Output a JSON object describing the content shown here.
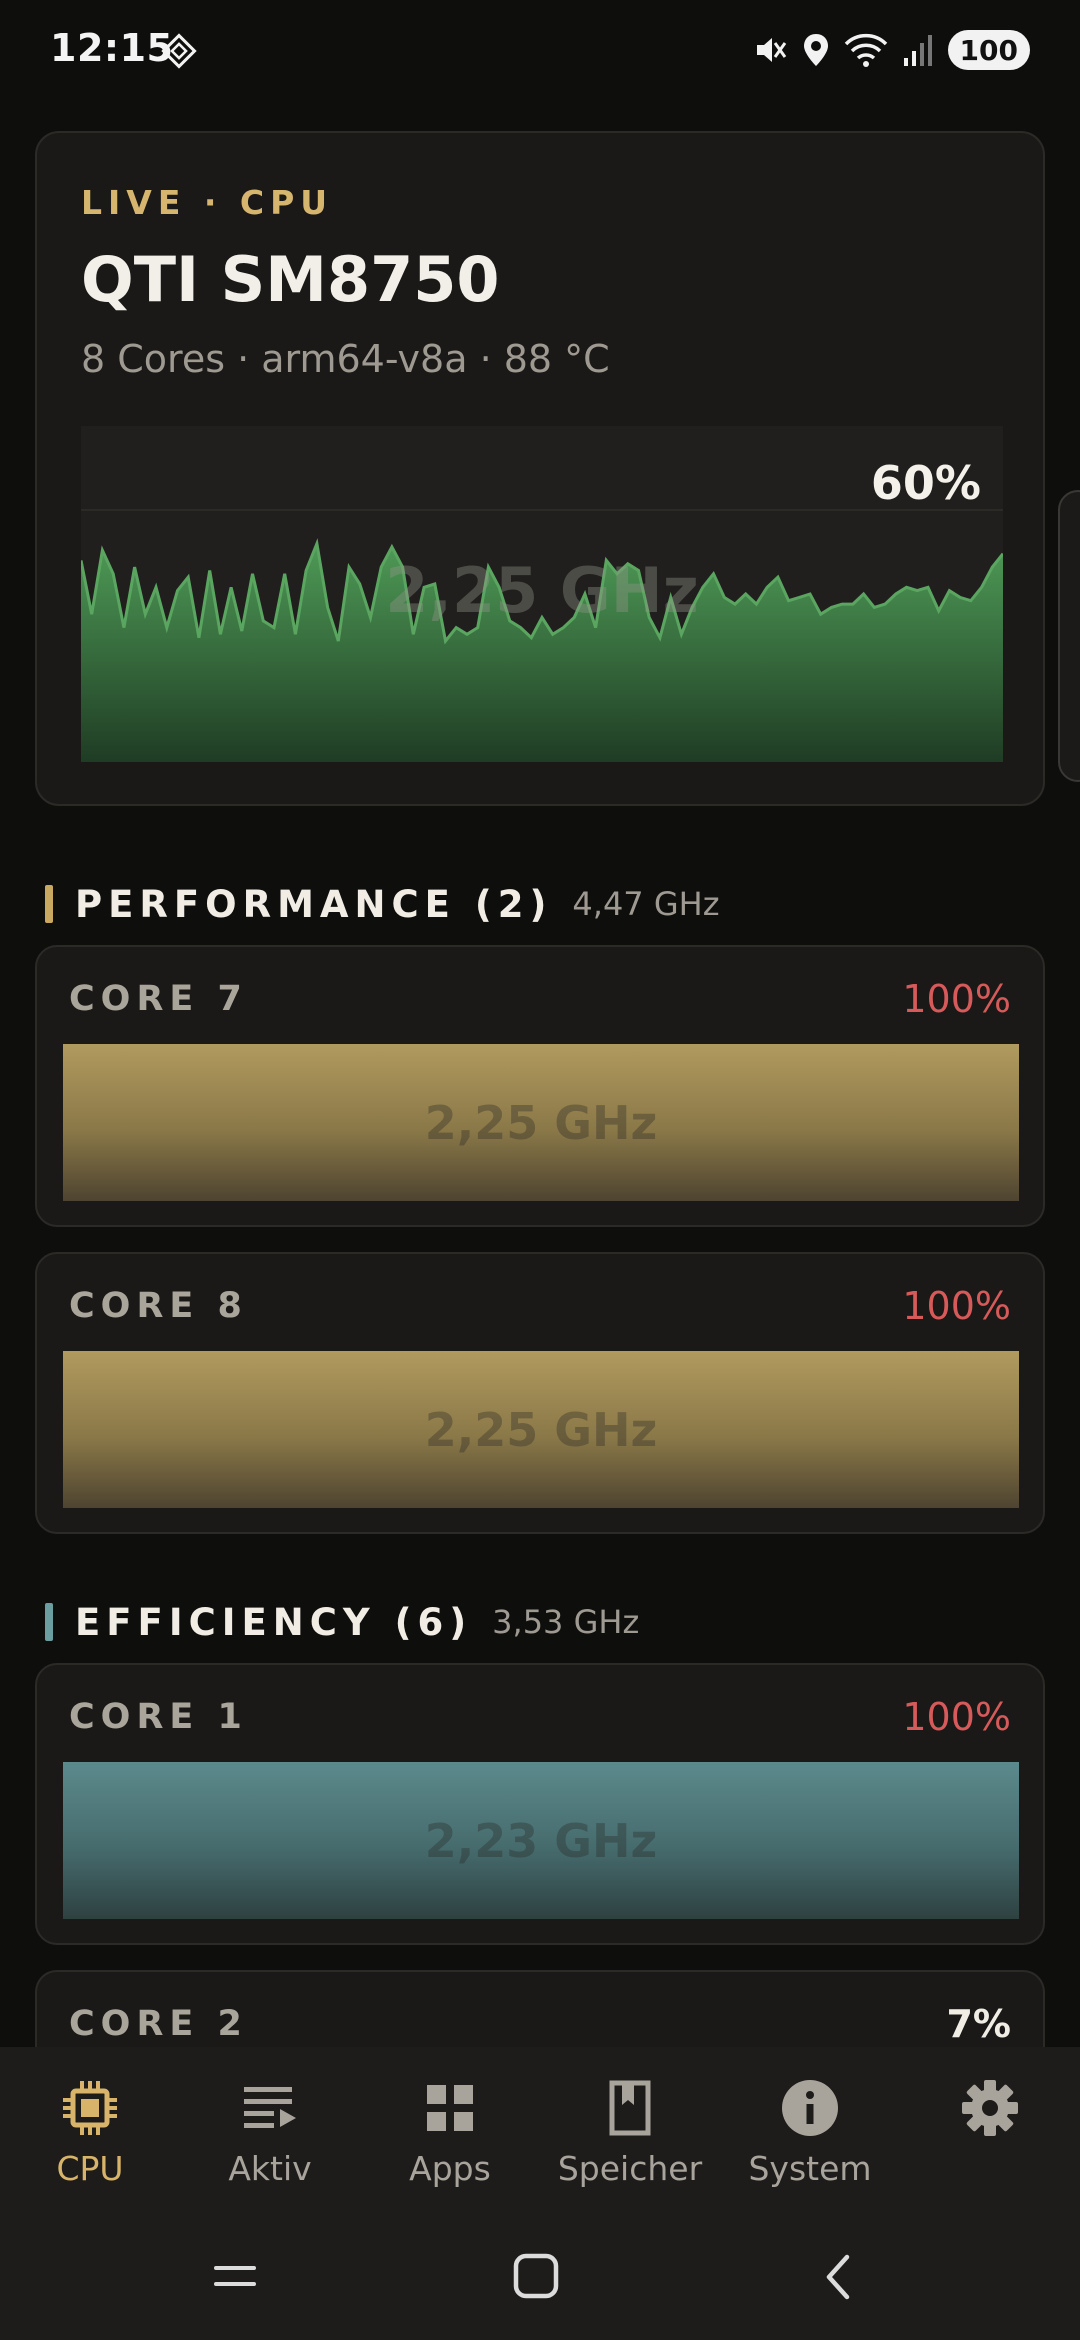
{
  "status_bar": {
    "time": "12:15",
    "battery": "100",
    "icons": [
      "mute-icon",
      "location-icon",
      "wifi-icon",
      "signal-icon"
    ]
  },
  "live_card": {
    "eyebrow": "LIVE · CPU",
    "title": "QTI SM8750",
    "subtitle": "8 Cores · arm64-v8a · 88 °C",
    "graph_frequency": "2,25 GHz",
    "graph_percent": "60%",
    "graph_values": [
      60,
      44,
      63,
      56,
      40,
      58,
      44,
      52,
      40,
      51,
      55,
      37,
      57,
      38,
      52,
      39,
      56,
      42,
      40,
      56,
      38,
      57,
      65,
      46,
      36,
      58,
      53,
      43,
      58,
      64,
      58,
      38,
      52,
      53,
      36,
      40,
      38,
      40,
      58,
      52,
      42,
      40,
      37,
      43,
      38,
      40,
      43,
      50,
      40,
      60,
      56,
      59,
      57,
      43,
      37,
      49,
      38,
      46,
      52,
      56,
      49,
      47,
      50,
      47,
      52,
      55,
      48,
      49,
      50,
      44,
      46,
      47,
      47,
      50,
      46,
      47,
      50,
      52,
      51,
      52,
      45,
      51,
      49,
      48,
      52,
      58,
      62
    ],
    "colors": {
      "graph_line": "#5aa660",
      "accent": "#d6b66e"
    }
  },
  "sections": {
    "performance": {
      "title": "PERFORMANCE (2)",
      "max_freq": "4,47 GHz",
      "color": "#c9a860"
    },
    "efficiency": {
      "title": "EFFICIENCY (6)",
      "max_freq": "3,53 GHz",
      "color": "#6a9ea0"
    }
  },
  "cores": {
    "core7": {
      "name": "CORE 7",
      "percent": "100%",
      "freq": "2,25 GHz",
      "load": 1.0
    },
    "core8": {
      "name": "CORE 8",
      "percent": "100%",
      "freq": "2,25 GHz",
      "load": 1.0
    },
    "core1": {
      "name": "CORE 1",
      "percent": "100%",
      "freq": "2,23 GHz",
      "load": 1.0
    },
    "core2": {
      "name": "CORE 2",
      "percent": "7%",
      "load": 0.07
    }
  },
  "bottom_nav": {
    "items": [
      {
        "label": "CPU",
        "icon": "chip-icon",
        "active": true
      },
      {
        "label": "Aktiv",
        "icon": "list-icon"
      },
      {
        "label": "Apps",
        "icon": "grid-icon"
      },
      {
        "label": "Speicher",
        "icon": "sd-card-icon"
      },
      {
        "label": "System",
        "icon": "info-icon"
      },
      {
        "label": "",
        "icon": "gear-icon"
      }
    ]
  },
  "system_nav": [
    "recents-icon",
    "home-icon",
    "back-icon"
  ]
}
